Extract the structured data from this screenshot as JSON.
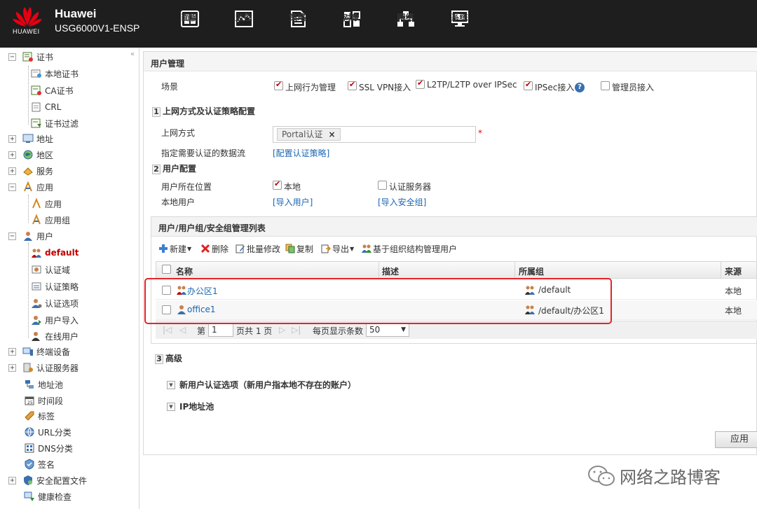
{
  "header": {
    "brand_name": "Huawei",
    "brand_model": "USG6000V1-ENSP",
    "logo_text": "HUAWEI",
    "nav": [
      {
        "label": "面板",
        "icon": "dashboard-icon"
      },
      {
        "label": "监控",
        "icon": "monitor-icon"
      },
      {
        "label": "策略",
        "icon": "policy-icon"
      },
      {
        "label": "对象",
        "icon": "object-icon"
      },
      {
        "label": "网络",
        "icon": "network-icon"
      },
      {
        "label": "系统",
        "icon": "system-icon"
      }
    ]
  },
  "sidebar": {
    "collapse": "«",
    "items": [
      {
        "label": "证书",
        "toggle": "−"
      },
      {
        "label": "本地证书"
      },
      {
        "label": "CA证书"
      },
      {
        "label": "CRL"
      },
      {
        "label": "证书过滤"
      },
      {
        "label": "地址",
        "toggle": "+"
      },
      {
        "label": "地区",
        "toggle": "+"
      },
      {
        "label": "服务",
        "toggle": "+"
      },
      {
        "label": "应用",
        "toggle": "−"
      },
      {
        "label": "应用"
      },
      {
        "label": "应用组"
      },
      {
        "label": "用户",
        "toggle": "−"
      },
      {
        "label": "default"
      },
      {
        "label": "认证域"
      },
      {
        "label": "认证策略"
      },
      {
        "label": "认证选项"
      },
      {
        "label": "用户导入"
      },
      {
        "label": "在线用户"
      },
      {
        "label": "终端设备",
        "toggle": "+"
      },
      {
        "label": "认证服务器",
        "toggle": "+"
      },
      {
        "label": "地址池"
      },
      {
        "label": "时间段"
      },
      {
        "label": "标签"
      },
      {
        "label": "URL分类"
      },
      {
        "label": "DNS分类"
      },
      {
        "label": "签名"
      },
      {
        "label": "安全配置文件",
        "toggle": "+"
      },
      {
        "label": "健康检查"
      }
    ]
  },
  "main": {
    "title": "用户管理",
    "scene_label": "场景",
    "scenes": [
      {
        "label": "上网行为管理",
        "checked": true
      },
      {
        "label": "SSL VPN接入",
        "checked": true
      },
      {
        "label": "L2TP/L2TP over IPSec",
        "checked": true
      },
      {
        "label": "IPSec接入",
        "checked": true
      },
      {
        "label": "管理员接入",
        "checked": false
      }
    ],
    "help_icon": "?",
    "section1": {
      "num": "1",
      "title": "上网方式及认证策略配置",
      "access_label": "上网方式",
      "access_tag": "Portal认证",
      "tag_remove": "×",
      "required_mark": "*",
      "flow_label": "指定需要认证的数据流",
      "flow_link": "[配置认证策略]"
    },
    "section2": {
      "num": "2",
      "title": "用户配置",
      "location_label": "用户所在位置",
      "loc_local": "本地",
      "loc_server": "认证服务器",
      "local_user_label": "本地用户",
      "import_user_link": "[导入用户]",
      "import_group_link": "[导入安全组]"
    },
    "list": {
      "title": "用户/用户组/安全组管理列表",
      "toolbar": {
        "new": "新建",
        "delete": "删除",
        "batch_edit": "批量修改",
        "copy": "复制",
        "export": "导出",
        "org_manage": "基于组织结构管理用户"
      },
      "columns": [
        "名称",
        "描述",
        "所属组",
        "来源"
      ],
      "rows": [
        {
          "name": "办公区1",
          "desc": "",
          "group": "/default",
          "source": "本地"
        },
        {
          "name": "office1",
          "desc": "",
          "group": "/default/办公区1",
          "source": "本地"
        }
      ],
      "pager": {
        "first": "|◁",
        "prev": "◁",
        "page_prefix": "第",
        "page": "1",
        "page_suffix": "页共 1 页",
        "next": "▷",
        "last": "▷|",
        "per_page_label": "每页显示条数",
        "per_page": "50"
      }
    },
    "section3": {
      "num": "3",
      "title": "高级",
      "opt1": "新用户认证选项（新用户指本地不存在的账户）",
      "opt2": "IP地址池"
    },
    "apply_label": "应用"
  },
  "watermark": "网络之路博客",
  "colors": {
    "header_bg": "#1e1e1e",
    "accent_red": "#c00000",
    "link_blue": "#1a66b3",
    "highlight_box": "#e3242b"
  }
}
